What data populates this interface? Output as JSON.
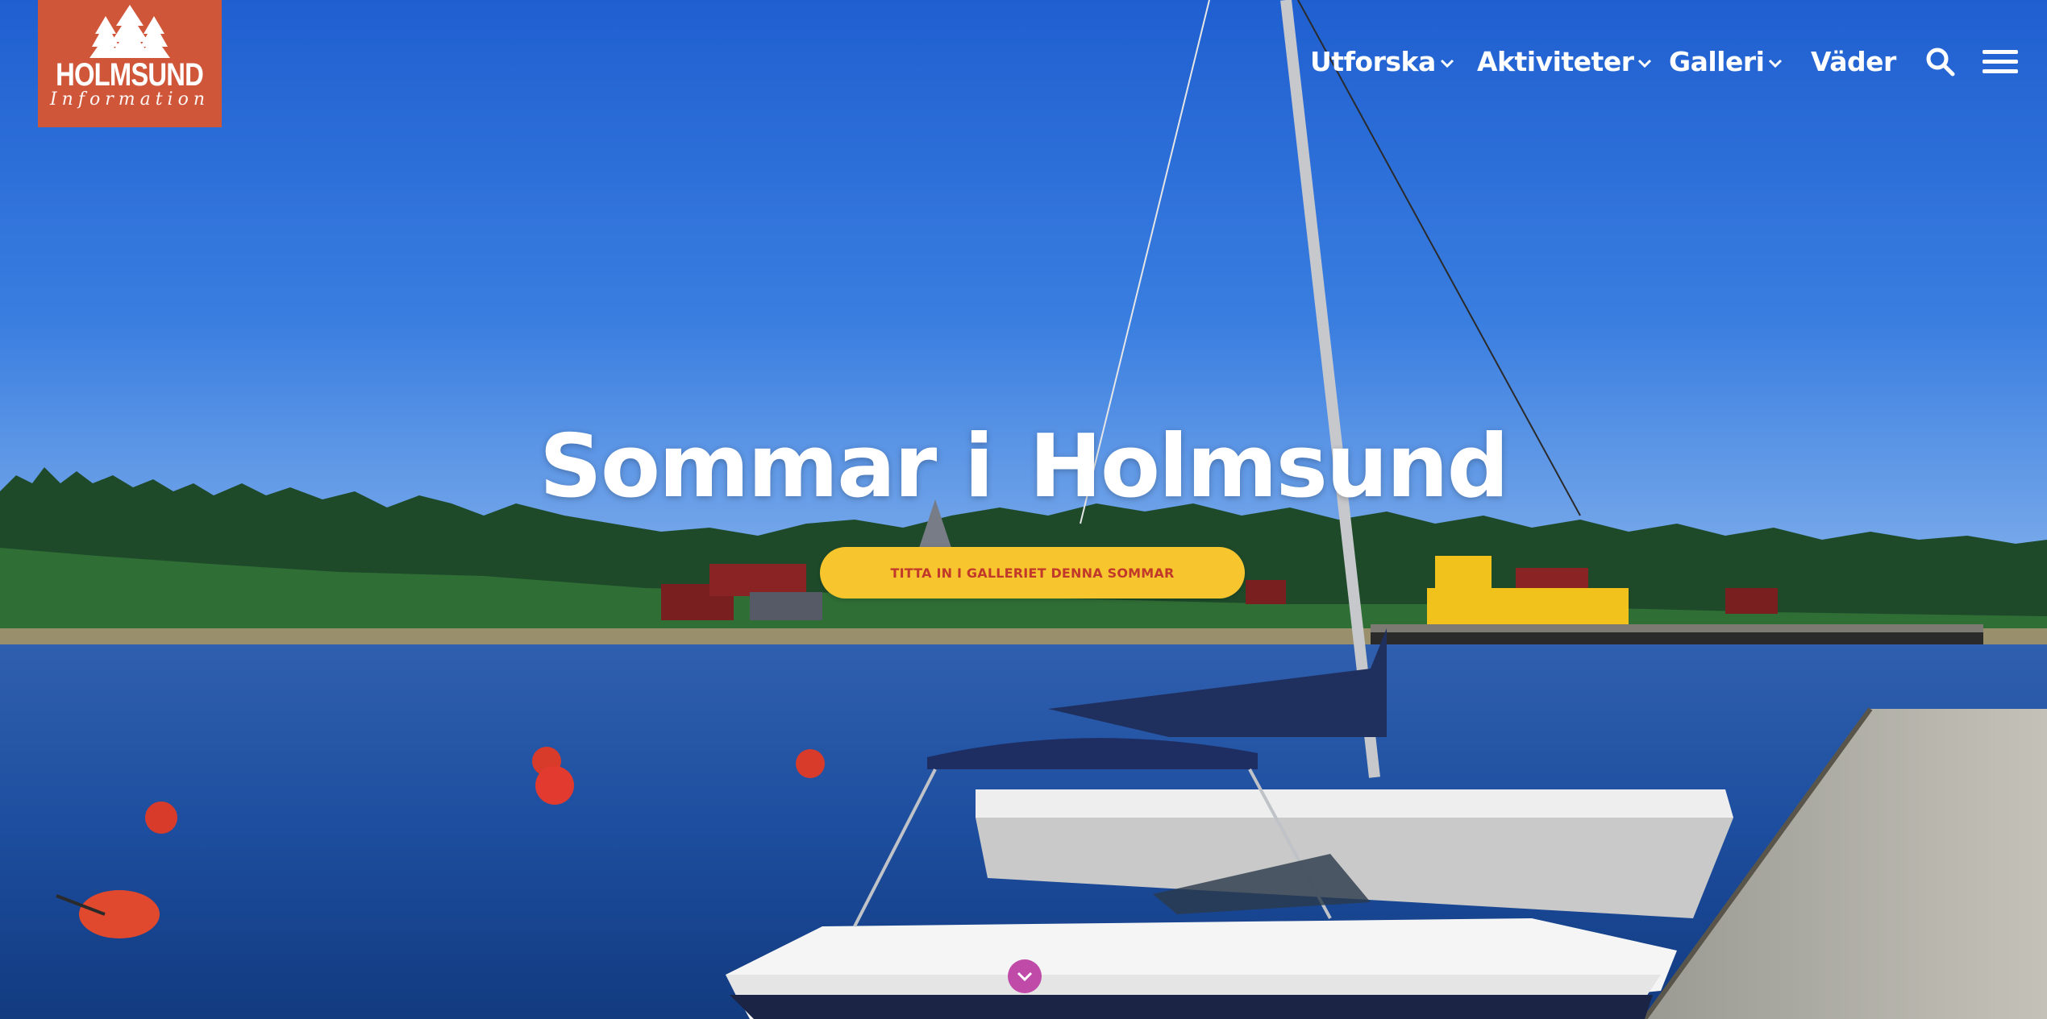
{
  "logo": {
    "name": "HOLMSUND",
    "sub": "Information"
  },
  "nav": {
    "items": [
      {
        "label": "Utforska",
        "has_dropdown": true
      },
      {
        "label": "Aktiviteter",
        "has_dropdown": true
      },
      {
        "label": "Galleri",
        "has_dropdown": true
      },
      {
        "label": "Väder",
        "has_dropdown": false
      }
    ],
    "search_icon": "search-icon",
    "menu_icon": "hamburger-menu-icon"
  },
  "hero": {
    "title_part1": "Sommar i",
    "title_part2": "Holmsund",
    "cta_label": "TITTA IN I GALLERIET DENNA SOMMAR",
    "scroll_icon": "chevron-down-icon"
  },
  "colors": {
    "logo_bg": "#d0563a",
    "cta_bg": "#f7c52d",
    "cta_text": "#c0392b",
    "scroll_button": "#c04aa8"
  }
}
